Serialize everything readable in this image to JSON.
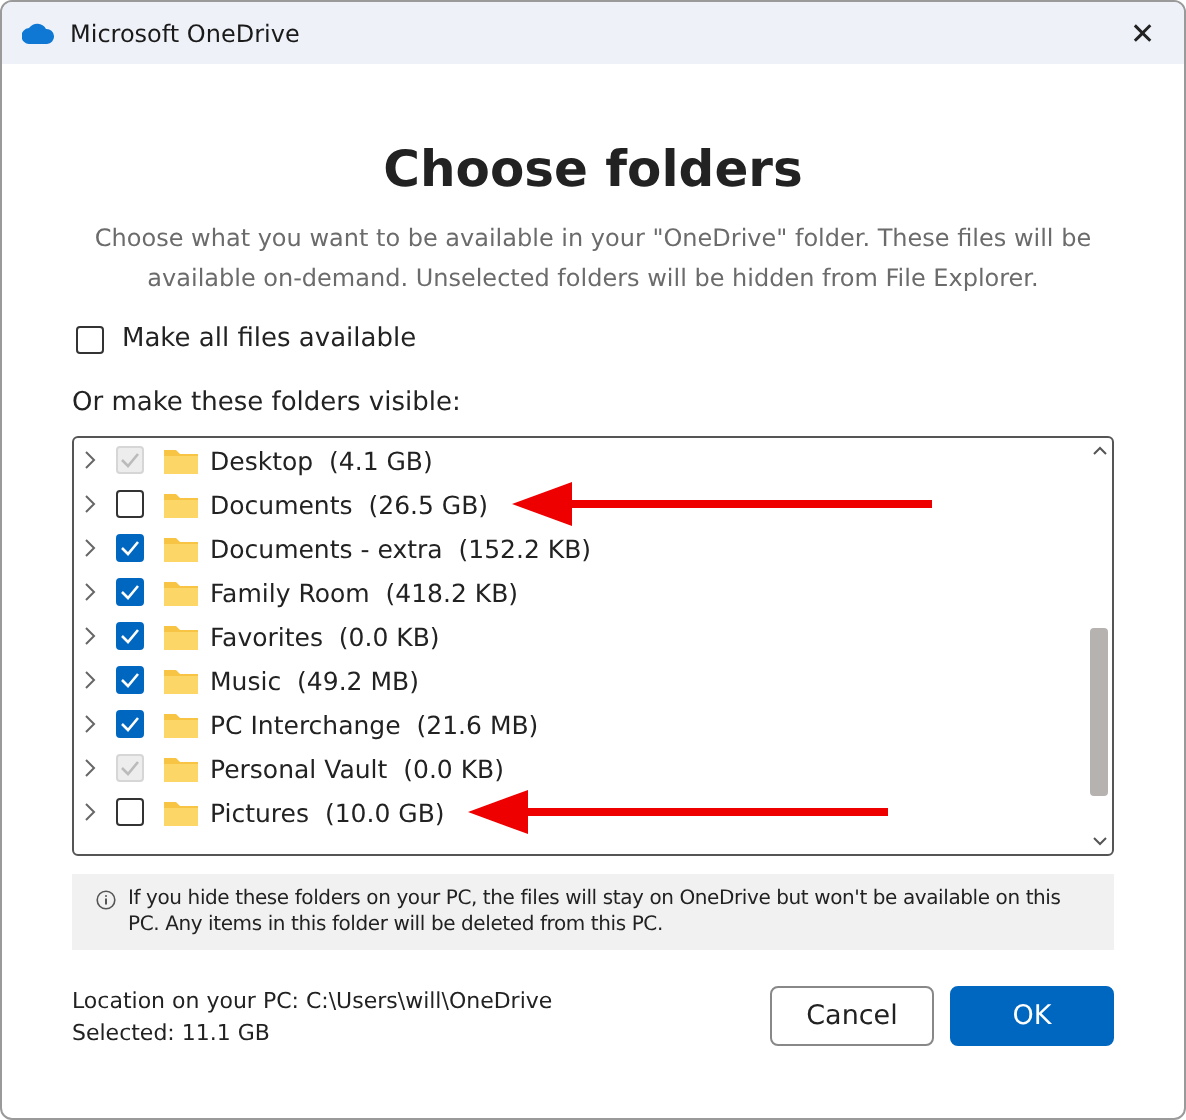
{
  "window": {
    "title": "Microsoft OneDrive",
    "close": "✕"
  },
  "heading": "Choose folders",
  "description": "Choose what you want to be available in your \"OneDrive\" folder. These files will be available on-demand. Unselected folders will be hidden from File Explorer.",
  "make_all": {
    "label": "Make all files available",
    "checked": false
  },
  "folders_label": "Or make these folders visible:",
  "folders": [
    {
      "name": "Desktop",
      "size": "(4.1 GB)",
      "checked": true,
      "disabled": true,
      "arrow": false
    },
    {
      "name": "Documents",
      "size": "(26.5 GB)",
      "checked": false,
      "disabled": false,
      "arrow": true
    },
    {
      "name": "Documents - extra",
      "size": "(152.2 KB)",
      "checked": true,
      "disabled": false,
      "arrow": false
    },
    {
      "name": "Family Room",
      "size": "(418.2 KB)",
      "checked": true,
      "disabled": false,
      "arrow": false
    },
    {
      "name": "Favorites",
      "size": "(0.0 KB)",
      "checked": true,
      "disabled": false,
      "arrow": false
    },
    {
      "name": "Music",
      "size": "(49.2 MB)",
      "checked": true,
      "disabled": false,
      "arrow": false
    },
    {
      "name": "PC Interchange",
      "size": "(21.6 MB)",
      "checked": true,
      "disabled": false,
      "arrow": false
    },
    {
      "name": "Personal Vault",
      "size": "(0.0 KB)",
      "checked": true,
      "disabled": true,
      "arrow": false
    },
    {
      "name": "Pictures",
      "size": "(10.0 GB)",
      "checked": false,
      "disabled": false,
      "arrow": true
    }
  ],
  "info": "If you hide these folders on your PC, the files will stay on OneDrive but won't be available on this PC. Any items in this folder will be deleted from this PC.",
  "location": "Location on your PC: C:\\Users\\will\\OneDrive",
  "selected": "Selected: 11.1 GB",
  "buttons": [
    {
      "label": "Cancel",
      "kind": "secondary"
    },
    {
      "label": "OK",
      "kind": "primary"
    }
  ]
}
